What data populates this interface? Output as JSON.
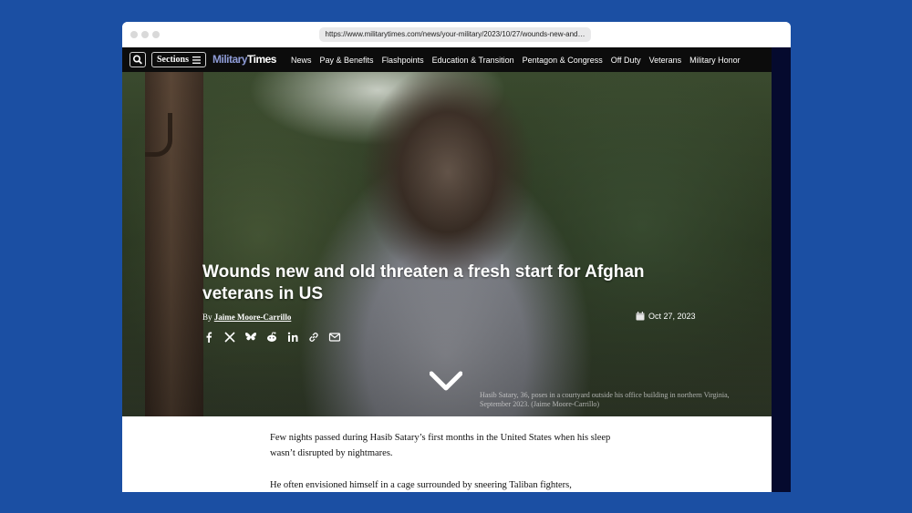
{
  "browser": {
    "url": "https://www.militarytimes.com/news/your-military/2023/10/27/wounds-new-and…"
  },
  "nav": {
    "sections_label": "Sections",
    "logo_part1": "Military",
    "logo_part2": "Times",
    "links": [
      "News",
      "Pay & Benefits",
      "Flashpoints",
      "Education & Transition",
      "Pentagon & Congress",
      "Off Duty",
      "Veterans",
      "Military Honor"
    ]
  },
  "hero": {
    "headline": "Wounds new and old threaten a fresh start for Afghan veterans in US",
    "byline_prefix": "By",
    "author": "Jaime Moore-Carrillo",
    "date": "Oct 27, 2023",
    "share_icons": [
      "facebook-icon",
      "x-icon",
      "bluesky-icon",
      "reddit-icon",
      "linkedin-icon",
      "link-icon",
      "email-icon"
    ],
    "caption": "Hasib Satary, 36, poses in a courtyard outside his office building in northern Virginia, September 2023. (Jaime Moore-Carrillo)"
  },
  "article": {
    "paragraphs": [
      "Few nights passed during Hasib Satary’s first months in the United States when his sleep wasn’t disrupted by nightmares.",
      "He often envisioned himself in a cage surrounded by sneering Taliban fighters,"
    ]
  },
  "colors": {
    "background": "#1b4fa3",
    "navbar": "#0c0c0c",
    "logo_accent": "#8e9bd6",
    "right_rail": "#050a2e"
  }
}
